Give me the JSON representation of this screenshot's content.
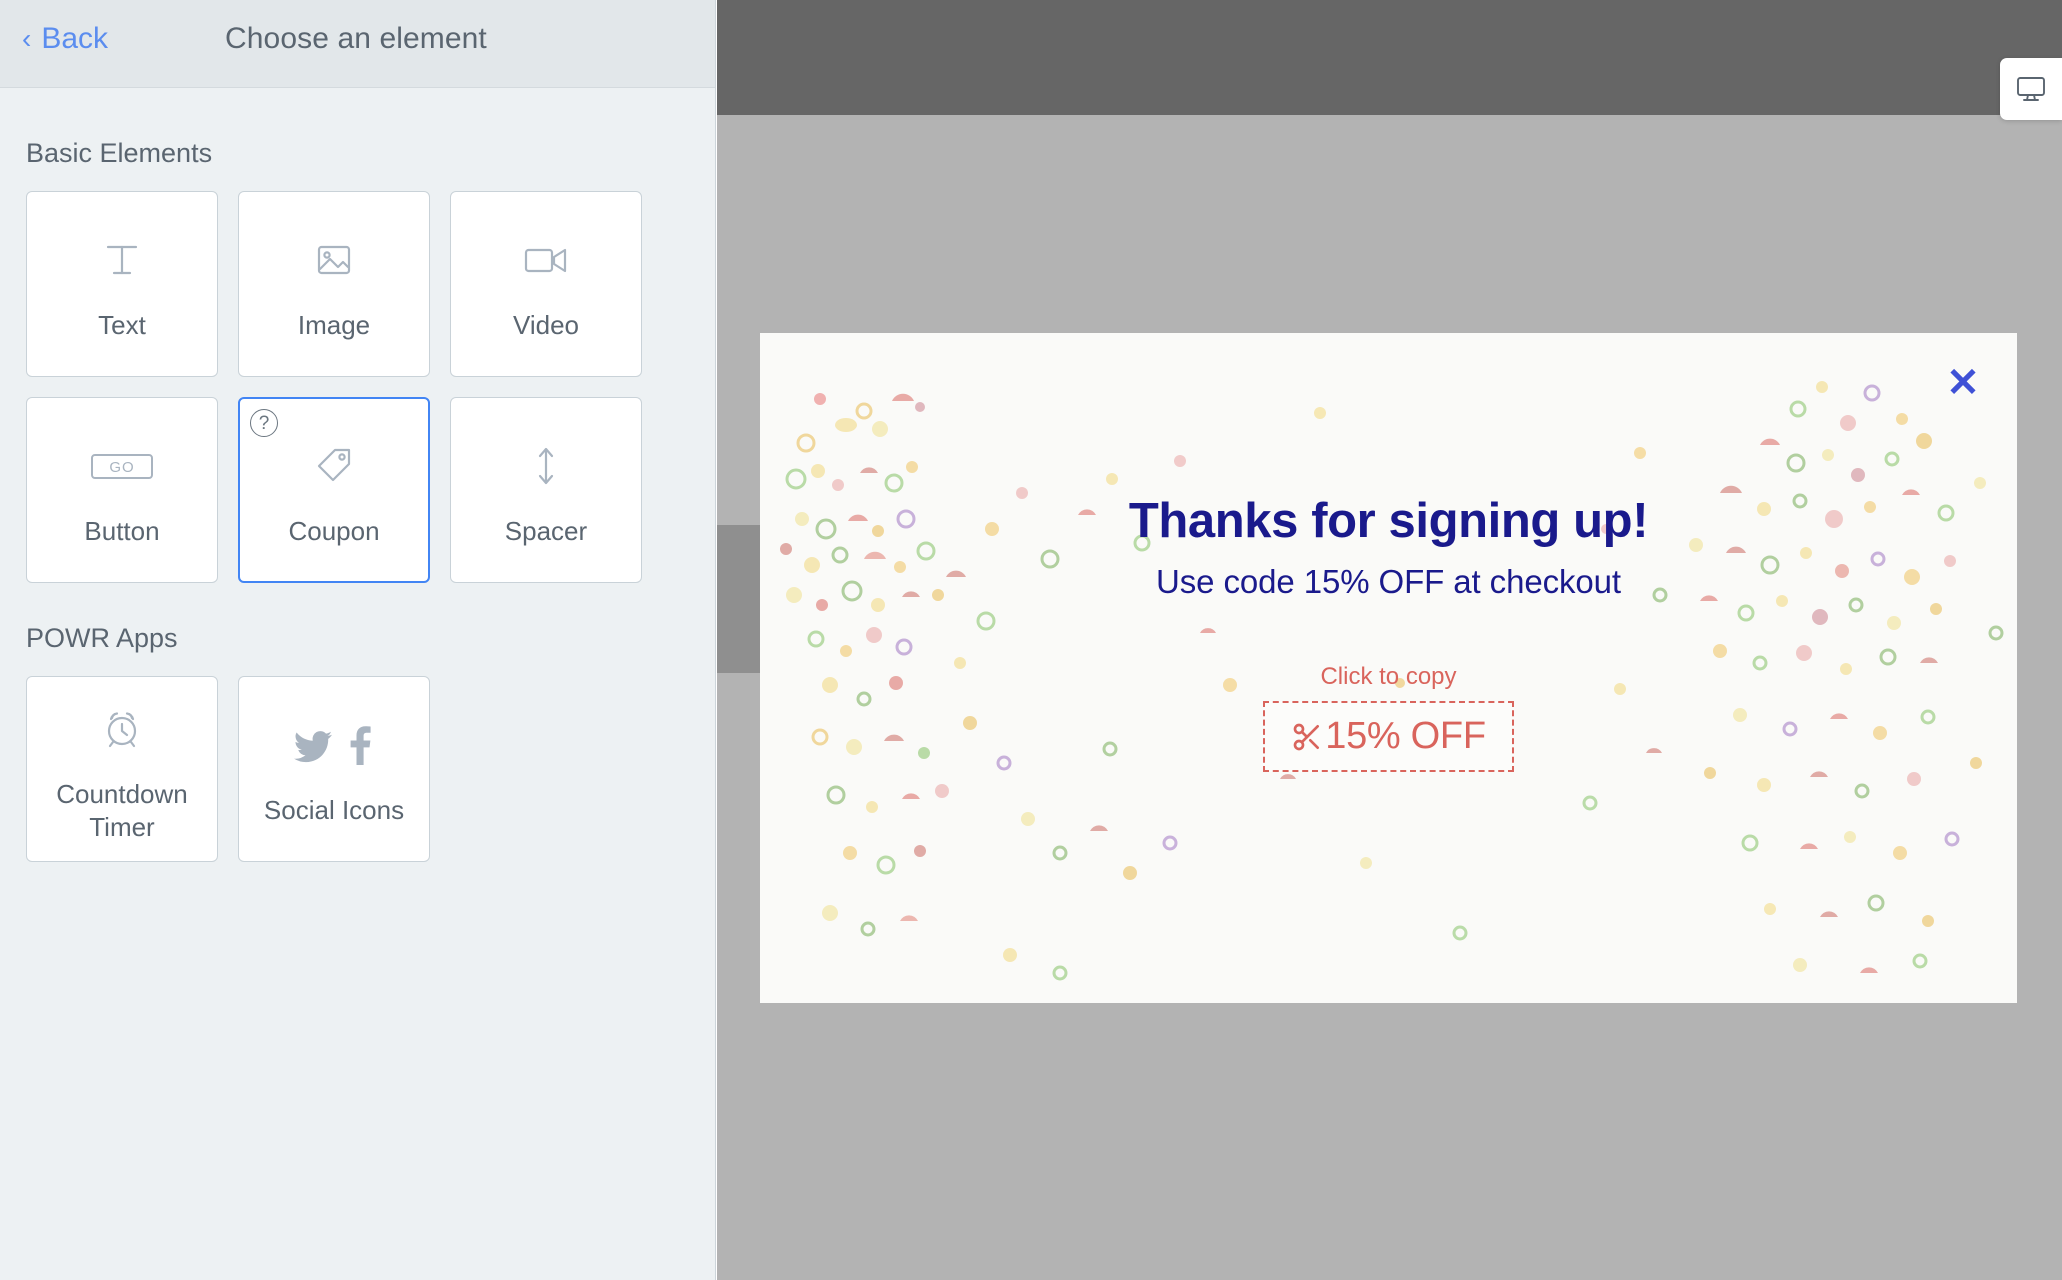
{
  "sidebar": {
    "back_label": "Back",
    "back_chevron": "chevron-left-icon",
    "title": "Choose an element",
    "sections": [
      {
        "heading": "Basic Elements",
        "items": [
          {
            "label": "Text",
            "icon": "text-t-icon",
            "selected": false,
            "has_help": false
          },
          {
            "label": "Image",
            "icon": "image-icon",
            "selected": false,
            "has_help": false
          },
          {
            "label": "Video",
            "icon": "video-camera-icon",
            "selected": false,
            "has_help": false
          },
          {
            "label": "Button",
            "icon": "go-button-icon",
            "selected": false,
            "has_help": false
          },
          {
            "label": "Coupon",
            "icon": "price-tag-icon",
            "selected": true,
            "has_help": true,
            "help_glyph": "?"
          },
          {
            "label": "Spacer",
            "icon": "vertical-arrows-icon",
            "selected": false,
            "has_help": false
          }
        ]
      },
      {
        "heading": "POWR Apps",
        "items": [
          {
            "label": "Countdown Timer",
            "icon": "alarm-clock-icon",
            "selected": false,
            "has_help": false
          },
          {
            "label": "Social Icons",
            "icon": "twitter-facebook-icon",
            "selected": false,
            "has_help": false
          }
        ]
      }
    ]
  },
  "preview": {
    "device_toggle_icon": "desktop-monitor-icon",
    "popup": {
      "close_icon": "close-x-icon",
      "heading": "Thanks for signing up!",
      "subheading": "Use code 15% OFF at checkout",
      "coupon_hint": "Click to copy",
      "coupon_code": "15% OFF",
      "coupon_icon": "scissors-icon"
    }
  },
  "colors": {
    "accent_blue": "#4285f4",
    "link_blue": "#5b8def",
    "popup_navy": "#1a1a8c",
    "coupon_red": "#d9645c",
    "close_indigo": "#3f51d6",
    "sidebar_bg": "#edf1f3",
    "sidebar_header_bg": "#e2e7ea",
    "site_topbar": "#666666",
    "site_body": "#b3b3b3",
    "popup_bg": "#fafaf8"
  }
}
